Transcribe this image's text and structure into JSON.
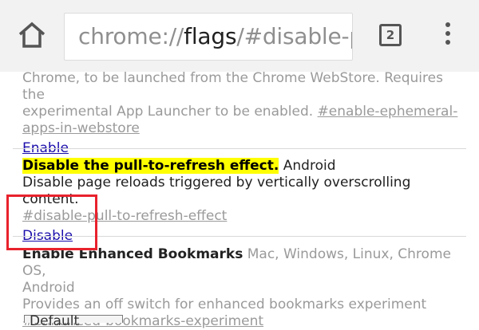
{
  "toolbar": {
    "url_scheme": "chrome://",
    "url_host": "flags",
    "url_rest": "/#disable-p",
    "tab_count": "2"
  },
  "experiments": [
    {
      "desc_lines": [
        "Chrome, to be launched from the Chrome WebStore. Requires the",
        "experimental App Launcher to be enabled. "
      ],
      "anchor_line1": "#enable-ephemeral-",
      "anchor_line2": "apps-in-webstore",
      "action": "Enable"
    },
    {
      "title": "Disable the pull-to-refresh effect.",
      "platforms": " Android",
      "description": "Disable page reloads triggered by vertically overscrolling content.",
      "anchor": "#disable-pull-to-refresh-effect",
      "action": "Disable"
    },
    {
      "title": "Enable Enhanced Bookmarks",
      "platforms": " Mac, Windows, Linux, Chrome OS,",
      "platforms_line2": "Android",
      "description": "Provides an off switch for enhanced bookmarks experiment",
      "anchor": "#enhanced-bookmarks-experiment",
      "select_value": "Default"
    }
  ],
  "colors": {
    "link": "#1a0dab",
    "highlight": "#ffff00",
    "annotation": "#e8222c"
  }
}
